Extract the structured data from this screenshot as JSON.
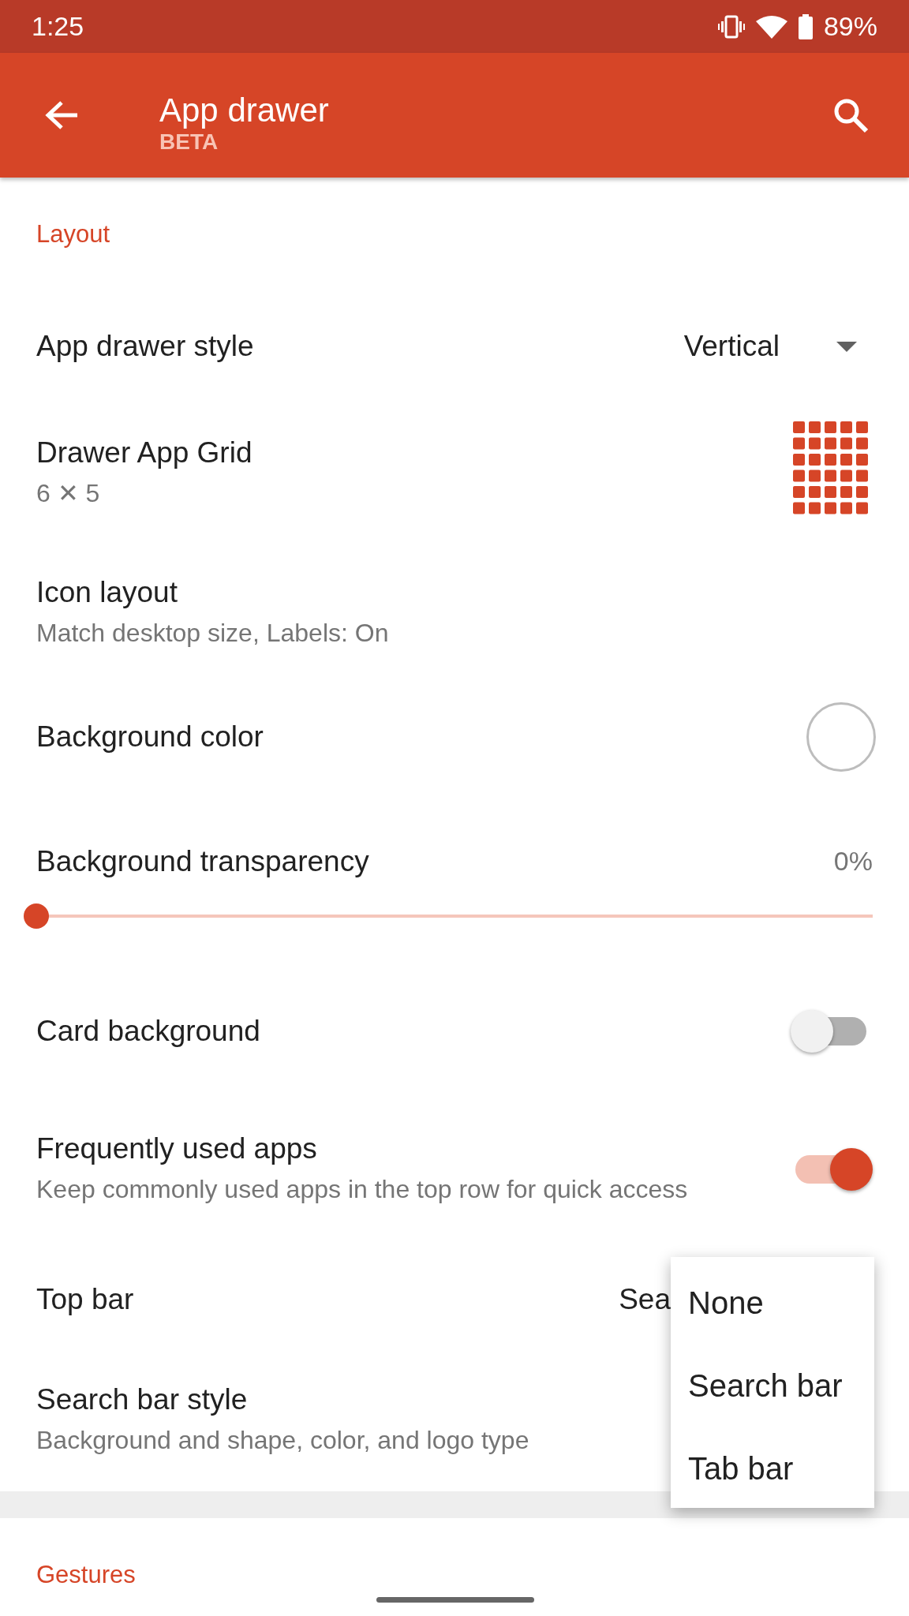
{
  "status_bar": {
    "time": "1:25",
    "battery": "89%"
  },
  "toolbar": {
    "title": "App drawer",
    "badge": "BETA"
  },
  "sections": [
    {
      "header": "Layout",
      "items": [
        {
          "kind": "dropdown",
          "title": "App drawer style",
          "value": "Vertical"
        },
        {
          "kind": "grid",
          "title": "Drawer App Grid",
          "subtitle": "6 ✕ 5"
        },
        {
          "kind": "text",
          "title": "Icon layout",
          "subtitle": "Match desktop size, Labels: On"
        },
        {
          "kind": "swatch",
          "title": "Background color"
        },
        {
          "kind": "slider",
          "title": "Background transparency",
          "reading": "0%",
          "level": 0
        },
        {
          "kind": "switch",
          "title": "Card background",
          "on": false
        },
        {
          "kind": "switch",
          "title": "Frequently used apps",
          "subtitle": "Keep commonly used apps in the top row for quick access",
          "on": true
        },
        {
          "kind": "value",
          "title": "Top bar",
          "value": "Sea"
        },
        {
          "kind": "text",
          "title": "Search bar style",
          "subtitle": "Background and shape, color, and logo type"
        }
      ]
    },
    {
      "header": "Gestures"
    }
  ],
  "popup_menu": {
    "items": [
      {
        "label": "None"
      },
      {
        "label": "Search bar"
      },
      {
        "label": "Tab bar"
      }
    ]
  }
}
